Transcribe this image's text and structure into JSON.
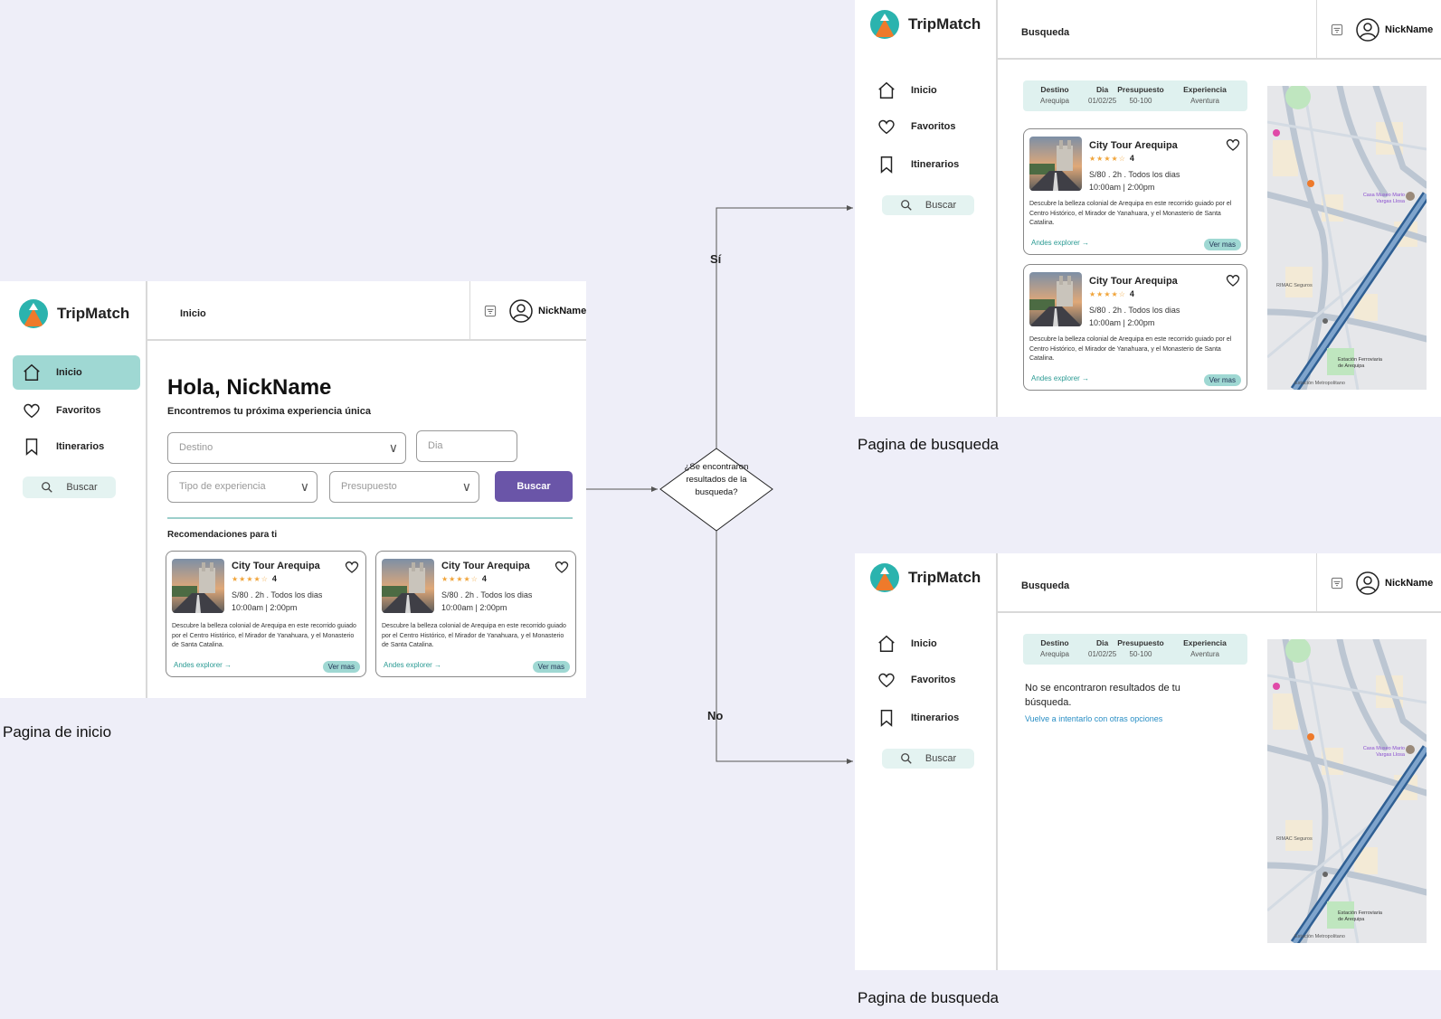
{
  "app": {
    "name": "TripMatch",
    "user": "NickName"
  },
  "nav": {
    "inicio": "Inicio",
    "favoritos": "Favoritos",
    "itinerarios": "Itinerarios",
    "buscar": "Buscar"
  },
  "home": {
    "header_title": "Inicio",
    "greeting": "Hola, NickName",
    "subtitle": "Encontremos tu próxima experiencia única",
    "destino_placeholder": "Destino",
    "dia_placeholder": "Dia",
    "tipo_placeholder": "Tipo de experiencia",
    "presupuesto_placeholder": "Presupuesto",
    "search_button": "Buscar",
    "recommendations_title": "Recomendaciones para ti",
    "caption": "Pagina de inicio"
  },
  "card": {
    "title": "City Tour Arequipa",
    "stars": "★★★★☆",
    "rating": "4",
    "price_line": "S/80 . 2h . Todos los dias",
    "times": "10:00am | 2:00pm",
    "description": "Descubre la belleza colonial de Arequipa en este recorrido guiado por el Centro Histórico, el Mirador de Yanahuara, y el Monasterio de Santa Catalina.",
    "provider": "Andes explorer →",
    "more": "Ver mas"
  },
  "search": {
    "header_title": "Busqueda",
    "filters": [
      {
        "label": "Destino",
        "value": "Arequipa"
      },
      {
        "label": "Dia",
        "value": "01/02/25"
      },
      {
        "label": "Presupuesto",
        "value": "50-100"
      },
      {
        "label": "Experiencia",
        "value": "Aventura"
      }
    ],
    "caption": "Pagina de busqueda",
    "empty_message": "No se encontraron resultados de tu búsqueda.",
    "empty_retry": "Vuelve a intentarlo con otras opciones"
  },
  "map": {
    "labels": [
      "Casa Museo Mario Vargas Llosa",
      "Estación Ferroviaria de Arequipa",
      "RIMAC Seguros",
      "Estación Metropolitano"
    ]
  },
  "flow": {
    "decision": "¿Se encontraron resultados de la busqueda?",
    "yes_label": "Sí",
    "no_label": "No"
  },
  "colors": {
    "teal": "#9fd8d3",
    "purple": "#6a55a8",
    "orange": "#ee7a2b",
    "background": "#eeeef8"
  }
}
